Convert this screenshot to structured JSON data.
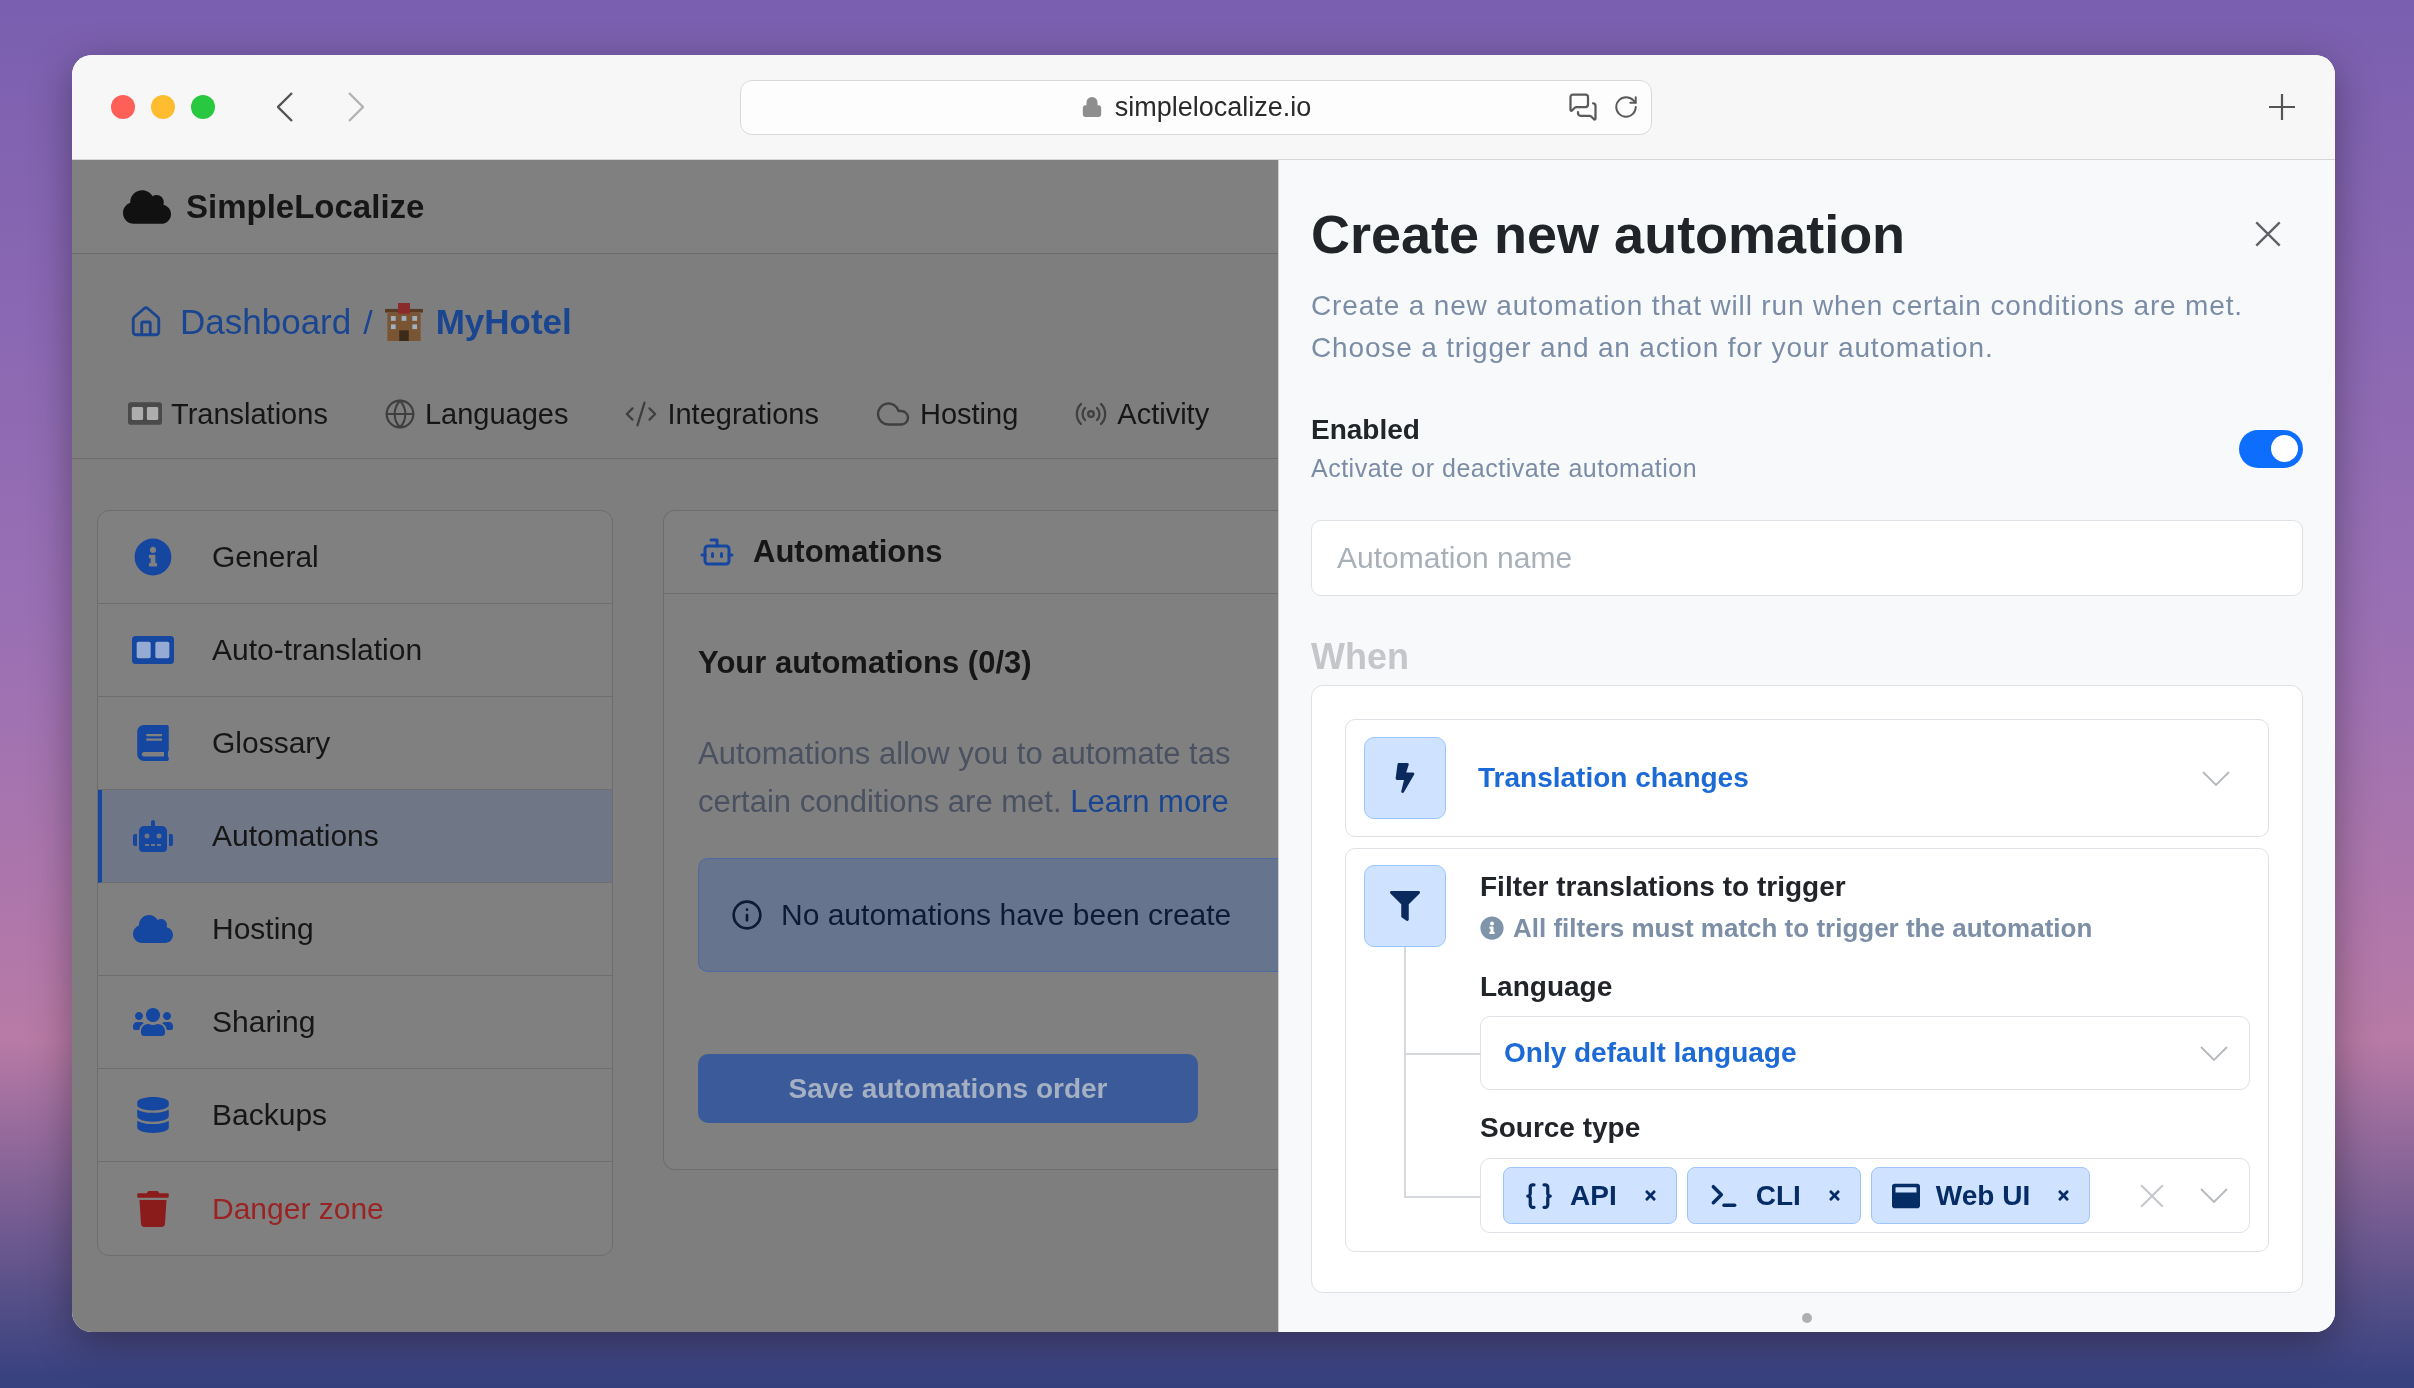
{
  "browser": {
    "navigation": [
      {
        "kind": "back",
        "disabled": false
      },
      {
        "kind": "forward",
        "disabled": true
      }
    ],
    "url": "simplelocalize.io"
  },
  "app": {
    "logo": "SimpleLocalize",
    "breadcrumb": {
      "separator": "/",
      "items": [
        {
          "label": "Dashboard",
          "current": false
        },
        {
          "label": "MyHotel",
          "current": true
        }
      ]
    },
    "tabs": [
      {
        "label": "Translations"
      },
      {
        "label": "Languages"
      },
      {
        "label": "Integrations"
      },
      {
        "label": "Hosting"
      },
      {
        "label": "Activity"
      }
    ],
    "sidebar": {
      "items": [
        {
          "label": "General",
          "kind": "default",
          "selected": false
        },
        {
          "label": "Auto-translation",
          "kind": "default",
          "selected": false
        },
        {
          "label": "Glossary",
          "kind": "default",
          "selected": false
        },
        {
          "label": "Automations",
          "kind": "default",
          "selected": true
        },
        {
          "label": "Hosting",
          "kind": "default",
          "selected": false
        },
        {
          "label": "Sharing",
          "kind": "default",
          "selected": false
        },
        {
          "label": "Backups",
          "kind": "default",
          "selected": false
        },
        {
          "label": "Danger zone",
          "kind": "danger",
          "selected": false
        }
      ]
    },
    "automations_card": {
      "title": "Automations",
      "heading": "Your automations (0/3)",
      "description_lines": [
        "Automations allow you to automate tas",
        "certain conditions are met."
      ],
      "link": "Learn more",
      "alert": "No automations have been create",
      "save_button": {
        "label": "Save automations order",
        "disabled": true
      }
    }
  },
  "drawer": {
    "title": "Create new automation",
    "description": "Create a new automation that will run when certain conditions are met. Choose a trigger and an action for your automation.",
    "enabled": {
      "label": "Enabled",
      "description": "Activate or deactivate automation",
      "on": true
    },
    "name_field": {
      "placeholder": "Automation name"
    },
    "when": {
      "heading": "When",
      "trigger": {
        "value": "Translation changes"
      },
      "filter": {
        "title": "Filter translations to trigger",
        "hint": "All filters must match to trigger the automation",
        "fields": [
          {
            "kind": "select",
            "label": "Language",
            "value": "Only default language"
          },
          {
            "kind": "multiselect",
            "label": "Source type",
            "values": [
              {
                "label": "API"
              },
              {
                "label": "CLI"
              },
              {
                "label": "Web UI"
              }
            ]
          }
        ]
      }
    }
  }
}
